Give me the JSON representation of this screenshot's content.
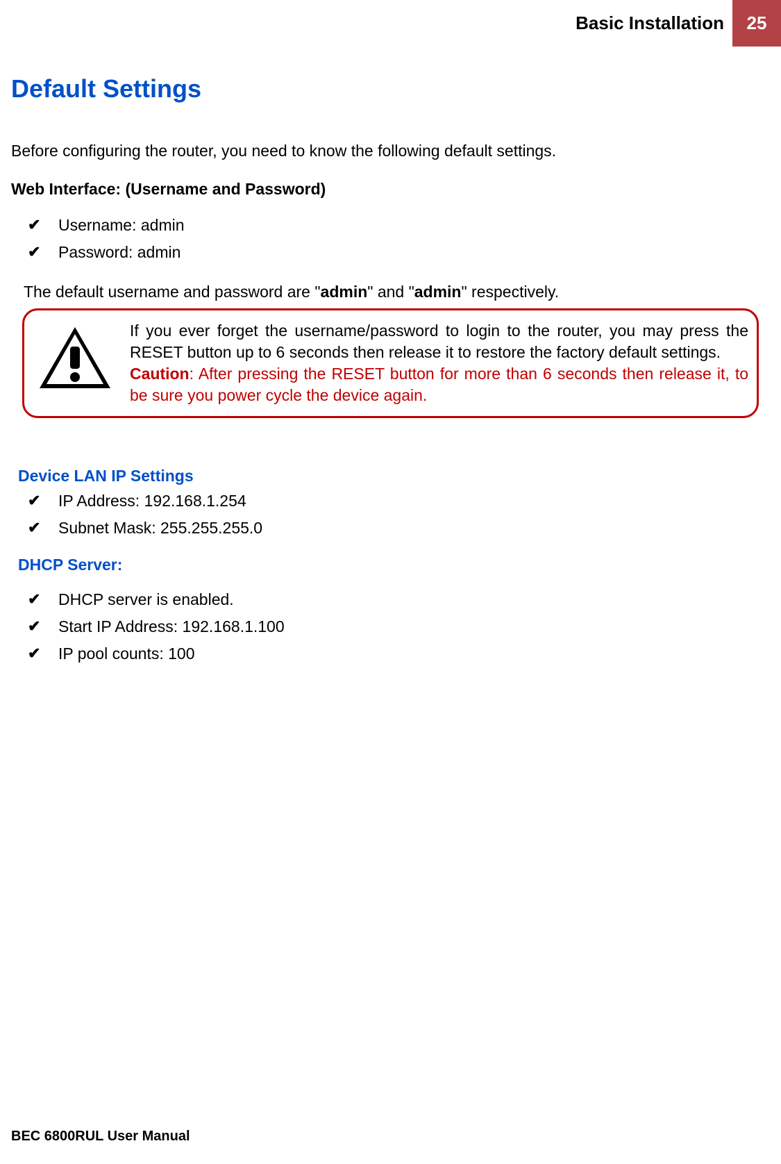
{
  "header": {
    "title": "Basic Installation",
    "page_number": "25"
  },
  "section_title": "Default Settings",
  "intro": "Before configuring the router, you need to know the following default settings.",
  "web_interface": {
    "heading": "Web Interface: (Username and Password)",
    "items": {
      "0": "Username: admin",
      "1": "Password: admin"
    },
    "note_prefix": "The default username and password are \"",
    "note_bold1": "admin",
    "note_mid": "\" and \"",
    "note_bold2": "admin",
    "note_suffix": "\" respectively."
  },
  "caution": {
    "text1": "If you ever forget the username/password to login to the router, you may press the RESET button up to 6 seconds then release it to restore the factory default settings.",
    "label": "Caution",
    "text2": ": After pressing the RESET button for more than 6 seconds then release it, to be sure you power cycle the device again."
  },
  "lan": {
    "heading": "Device LAN IP Settings",
    "items": {
      "0": "IP Address: 192.168.1.254",
      "1": "Subnet Mask: 255.255.255.0"
    }
  },
  "dhcp": {
    "heading": "DHCP Server:",
    "items": {
      "0": "DHCP server is enabled.",
      "1": "Start IP Address: 192.168.1.100",
      "2": "IP pool counts: 100"
    }
  },
  "footer": "BEC 6800RUL User Manual"
}
